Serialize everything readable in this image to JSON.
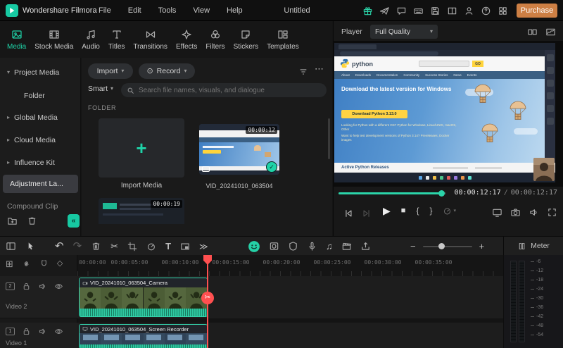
{
  "titlebar": {
    "app_name": "Wondershare Filmora",
    "menus": [
      "File",
      "Edit",
      "Tools",
      "View",
      "Help"
    ],
    "project_name": "Untitled",
    "purchase_label": "Purchase"
  },
  "tabs": [
    {
      "label": "Media"
    },
    {
      "label": "Stock Media"
    },
    {
      "label": "Audio"
    },
    {
      "label": "Titles"
    },
    {
      "label": "Transitions"
    },
    {
      "label": "Effects"
    },
    {
      "label": "Filters"
    },
    {
      "label": "Stickers"
    },
    {
      "label": "Templates"
    }
  ],
  "sidebar": {
    "items": [
      {
        "label": "Project Media"
      },
      {
        "label": "Folder"
      },
      {
        "label": "Global Media"
      },
      {
        "label": "Cloud Media"
      },
      {
        "label": "Influence Kit"
      },
      {
        "label": "Adjustment La..."
      },
      {
        "label": "Compound Clip"
      }
    ]
  },
  "media": {
    "import_button": "Import",
    "record_button": "Record",
    "smart_filter": "Smart",
    "search_placeholder": "Search file names, visuals, and dialogue",
    "section_label": "FOLDER",
    "items": [
      {
        "label": "Import Media"
      },
      {
        "label": "VID_20241010_063504",
        "duration": "00:00:12"
      }
    ],
    "partial_item_duration": "00:00:19"
  },
  "player": {
    "label": "Player",
    "quality": "Full Quality",
    "current_time": "00:00:12:17",
    "time_separator": "/",
    "total_time": "00:00:12:17"
  },
  "preview": {
    "logo_text": "python",
    "search_go": "GO",
    "nav": [
      "About",
      "Downloads",
      "Documentation",
      "Community",
      "Success Stories",
      "News",
      "Events"
    ],
    "heading": "Download the latest version for Windows",
    "download_button": "Download Python 3.13.0",
    "note1": "Looking for Python with a different OS? Python for Windows, Linux/UNIX, macOS, Other",
    "note2": "Want to help test development versions of Python 3.14? Prereleases, Docker images",
    "active_releases": "Active Python Releases"
  },
  "timeline": {
    "ruler": [
      "00:00:00",
      "00:00:05:00",
      "00:00:10:00",
      "00:00:15:00",
      "00:00:20:00",
      "00:00:25:00",
      "00:00:30:00",
      "00:00:35:00"
    ],
    "tracks": [
      {
        "number": "2",
        "name": "Video 2",
        "clip_label": "VID_20241010_063504_Camera"
      },
      {
        "number": "1",
        "name": "Video 1",
        "clip_label": "VID_20241010_063504_Screen Recorder"
      }
    ]
  },
  "meter": {
    "label": "Meter",
    "scale": [
      "-6",
      "-12",
      "-18",
      "-24",
      "-30",
      "-36",
      "-42",
      "-48",
      "-54"
    ]
  },
  "icons": {
    "chevron_down": "▾",
    "chevron_right": "▸",
    "collapse_left": "«",
    "plus": "+",
    "minus": "−",
    "check": "✓",
    "undo": "↶",
    "redo": "↷",
    "scissors": "✂",
    "ellipsis": "⋯",
    "double_chevron": "≫",
    "record": "⊙",
    "music_notes": "♫",
    "text_tool": "T",
    "play": "▶",
    "stop": "■",
    "mark_in": "{",
    "mark_out": "}",
    "add_track": "⊞",
    "keyframe": "◇"
  },
  "colors": {
    "accent": "#1fd3a8",
    "purchase": "#cd7f44",
    "playhead": "#ff5050"
  }
}
